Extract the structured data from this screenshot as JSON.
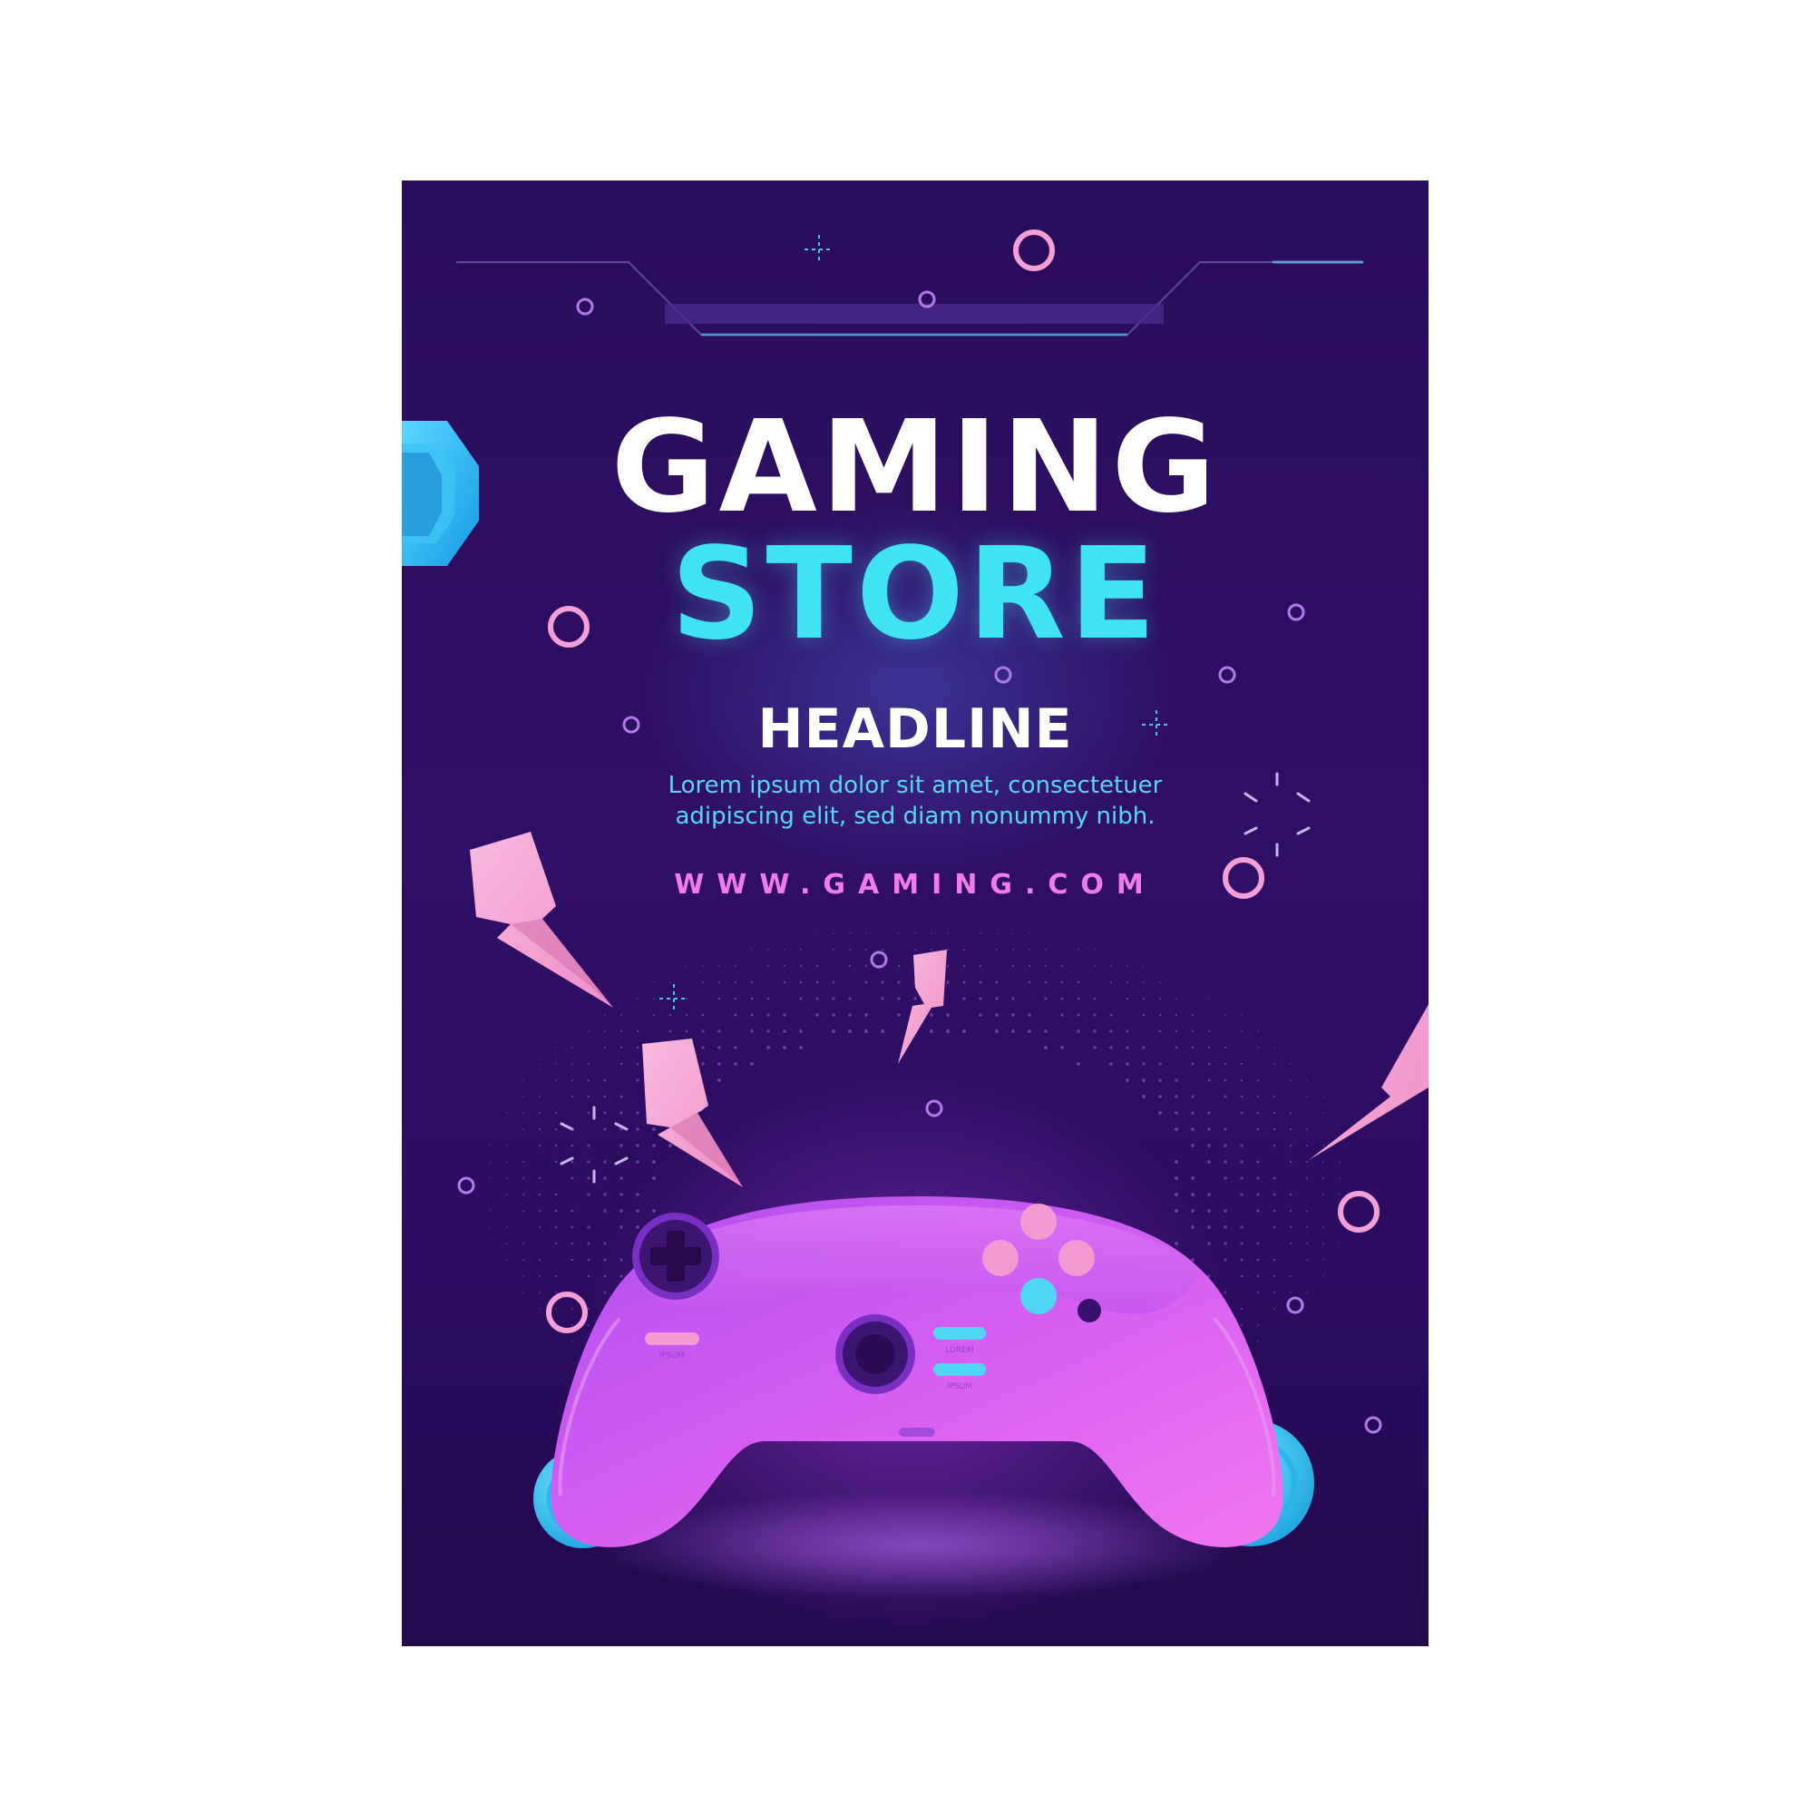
{
  "poster": {
    "title_line1": "GAMING",
    "title_line2": "STORE",
    "headline": "HEADLINE",
    "body_line1": "Lorem ipsum dolor sit amet, consectetuer",
    "body_line2": "adipiscing elit, sed diam nonummy nibh.",
    "url": "WWW.GAMING.COM"
  },
  "controller": {
    "left_button_label": "IPSUM",
    "right_top_label": "LOREM",
    "right_bottom_label": "IPSUM"
  },
  "colors": {
    "background": "#2c0c60",
    "title_white": "#ffffff",
    "title_cyan": "#3fe3f2",
    "body_cyan": "#58d8f0",
    "url_pink": "#f07ce8",
    "controller_purple": "#d65cf0",
    "coin_blue": "#3cc8ee",
    "bolt_pink": "#f4a4d4"
  },
  "icons": [
    "gamepad-icon",
    "lightning-bolt-icon",
    "star-coin-icon",
    "gem-icon",
    "ring-icon",
    "sparkle-icon"
  ]
}
